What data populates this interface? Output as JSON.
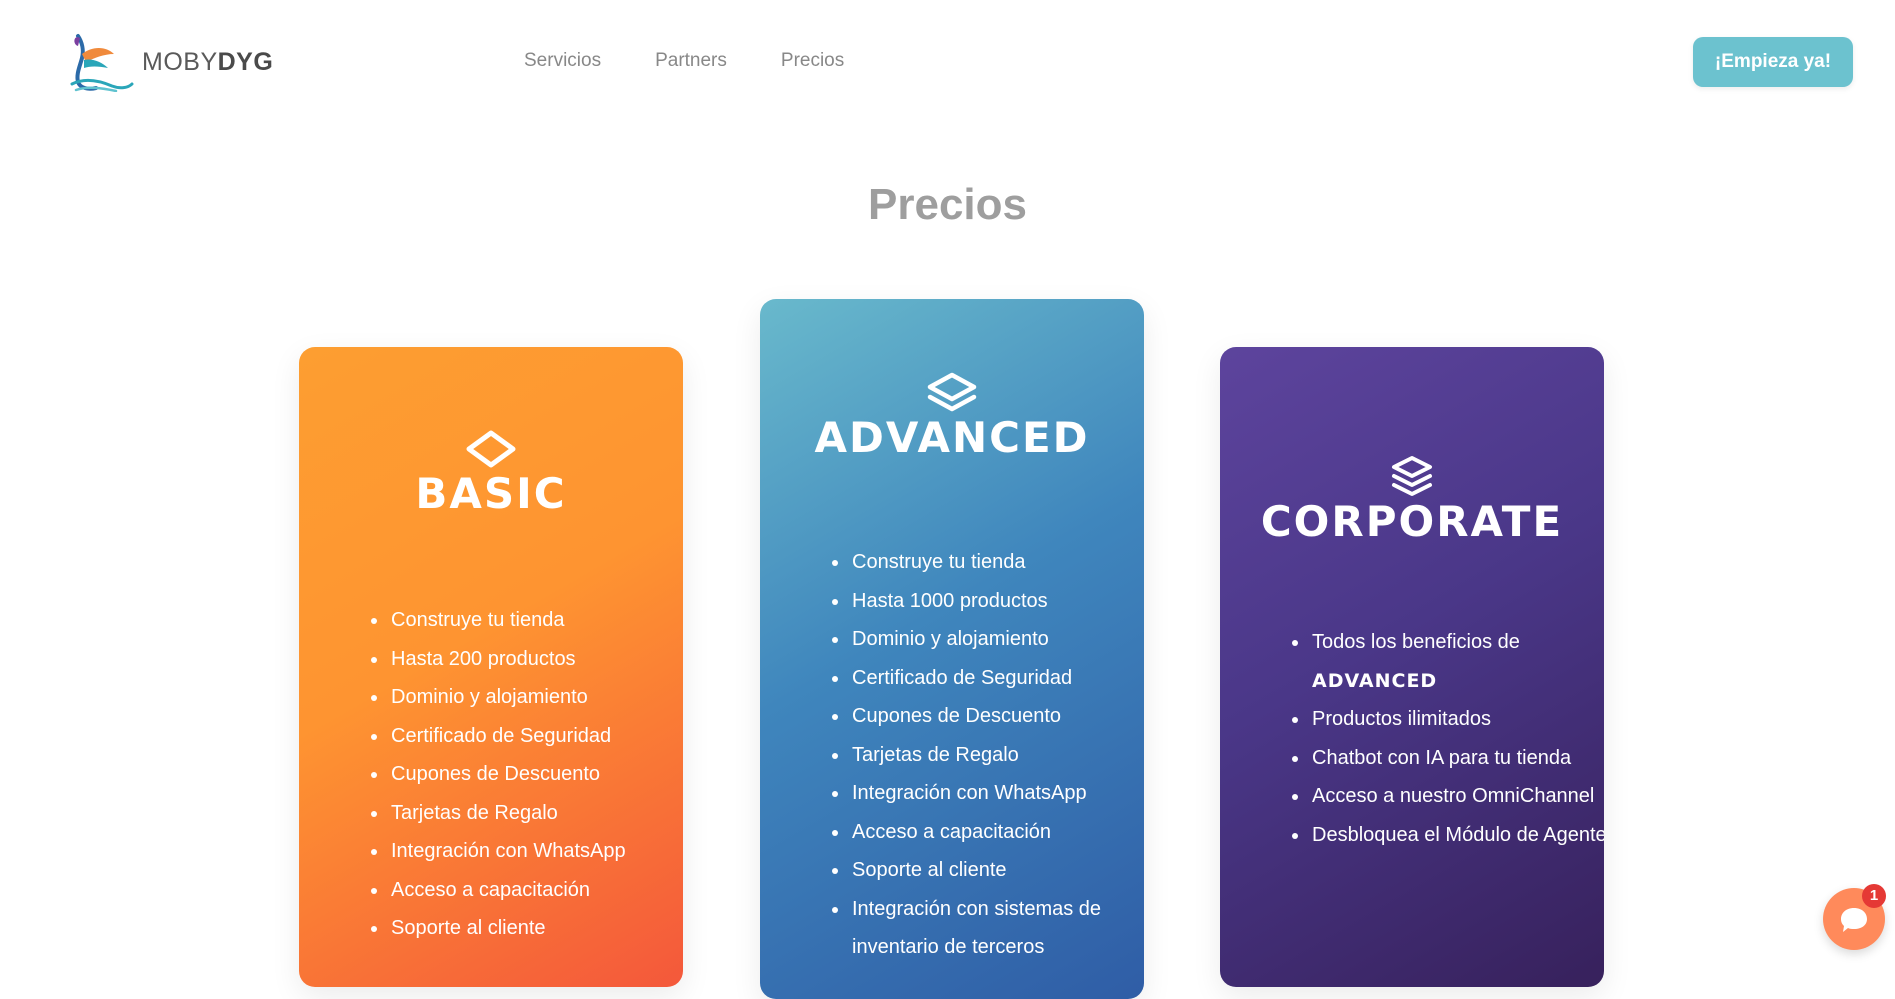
{
  "header": {
    "logo": {
      "light": "MOBY",
      "bold": "DYG"
    },
    "nav": [
      "Servicios",
      "Partners",
      "Precios"
    ],
    "cta_label": "¡Empieza ya!"
  },
  "section": {
    "title": "Precios"
  },
  "plans": [
    {
      "name": "BASIC",
      "icon": "diamond-layer-icon",
      "color": "#fe9431",
      "features": [
        "Construye tu tienda",
        "Hasta 200 productos",
        "Dominio y alojamiento",
        "Certificado de Seguridad",
        "Cupones de Descuento",
        "Tarjetas de Regalo",
        "Integración con WhatsApp",
        "Acceso a capacitación",
        "Soporte al cliente"
      ]
    },
    {
      "name": "ADVANCED",
      "icon": "double-layer-icon",
      "color": "#3f86bd",
      "features": [
        "Construye tu tienda",
        "Hasta 1000 productos",
        "Dominio y alojamiento",
        "Certificado de Seguridad",
        "Cupones de Descuento",
        "Tarjetas de Regalo",
        "Integración con WhatsApp",
        "Acceso a capacitación",
        "Soporte al cliente",
        "Integración con sistemas de inventario de terceros"
      ]
    },
    {
      "name": "CORPORATE",
      "icon": "triple-layer-icon",
      "color": "#4a3788",
      "features_prefix": "Todos los beneficios de",
      "features_highlight": "ADVANCED",
      "features": [
        "Productos ilimitados",
        "Chatbot con IA para tu tienda",
        "Acceso a nuestro OmniChannel",
        "Desbloquea el Módulo de Agente"
      ]
    }
  ],
  "chat": {
    "badge": "1",
    "icon": "chat-bubble-icon",
    "color": "#ff8a5b"
  }
}
